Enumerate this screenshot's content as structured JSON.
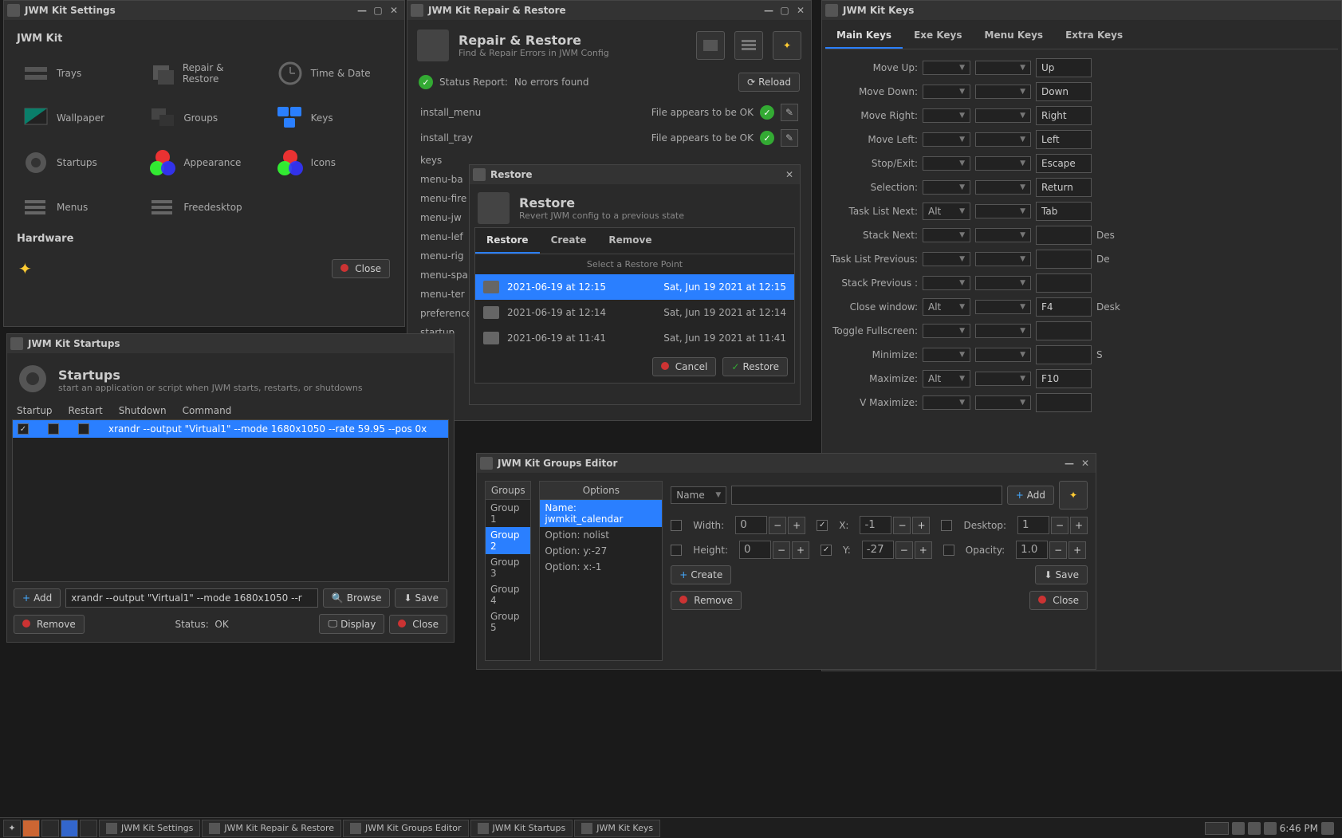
{
  "settings": {
    "title": "JWM Kit Settings",
    "jwm_section": "JWM Kit",
    "hardware_section": "Hardware",
    "close": "Close",
    "tiles": {
      "trays": "Trays",
      "repair": "Repair & Restore",
      "time": "Time & Date",
      "wallpaper": "Wallpaper",
      "groups": "Groups",
      "keys": "Keys",
      "startups": "Startups",
      "appearance": "Appearance",
      "icons": "Icons",
      "menus": "Menus",
      "freedesktop": "Freedesktop"
    }
  },
  "repair": {
    "title": "JWM Kit Repair & Restore",
    "header": "Repair & Restore",
    "sub": "Find & Repair Errors in JWM Config",
    "status_label": "Status Report:",
    "status_val": "No errors found",
    "reload": "Reload",
    "ok_text": "File appears to be OK",
    "files": [
      "install_menu",
      "install_tray",
      "keys",
      "menu-ba",
      "menu-fire",
      "menu-jw",
      "menu-lef",
      "menu-rig",
      "menu-spa",
      "menu-ter",
      "preference",
      "startup"
    ]
  },
  "restore": {
    "title": "Restore",
    "header": "Restore",
    "sub": "Revert JWM config to a previous state",
    "tabs": {
      "restore": "Restore",
      "create": "Create",
      "remove": "Remove"
    },
    "help": "Select a Restore Point",
    "cancel": "Cancel",
    "restore_btn": "Restore",
    "points": [
      {
        "short": "2021-06-19 at 12:15",
        "long": "Sat, Jun 19 2021 at 12:15"
      },
      {
        "short": "2021-06-19 at 12:14",
        "long": "Sat, Jun 19 2021 at 12:14"
      },
      {
        "short": "2021-06-19 at 11:41",
        "long": "Sat, Jun 19 2021 at 11:41"
      }
    ]
  },
  "startups": {
    "title": "JWM Kit Startups",
    "header": "Startups",
    "sub": "start an application or script when JWM starts, restarts, or shutdowns",
    "cols": {
      "startup": "Startup",
      "restart": "Restart",
      "shutdown": "Shutdown",
      "command": "Command"
    },
    "row_cmd": "xrandr --output \"Virtual1\" --mode 1680x1050 --rate 59.95 --pos 0x",
    "input_cmd": "xrandr --output \"Virtual1\" --mode 1680x1050 --r",
    "add": "Add",
    "browse": "Browse",
    "save": "Save",
    "remove": "Remove",
    "display": "Display",
    "close": "Close",
    "status_label": "Status:",
    "status_val": "OK"
  },
  "keys": {
    "title": "JWM Kit Keys",
    "tabs": {
      "main": "Main Keys",
      "exe": "Exe Keys",
      "menu": "Menu Keys",
      "extra": "Extra Keys"
    },
    "rows": [
      {
        "label": "Move Up:",
        "m1": "",
        "m2": "",
        "key": "Up",
        "ex": ""
      },
      {
        "label": "Move Down:",
        "m1": "",
        "m2": "",
        "key": "Down",
        "ex": ""
      },
      {
        "label": "Move Right:",
        "m1": "",
        "m2": "",
        "key": "Right",
        "ex": ""
      },
      {
        "label": "Move Left:",
        "m1": "",
        "m2": "",
        "key": "Left",
        "ex": ""
      },
      {
        "label": "Stop/Exit:",
        "m1": "",
        "m2": "",
        "key": "Escape",
        "ex": ""
      },
      {
        "label": "Selection:",
        "m1": "",
        "m2": "",
        "key": "Return",
        "ex": ""
      },
      {
        "label": "Task List Next:",
        "m1": "Alt",
        "m2": "",
        "key": "Tab",
        "ex": ""
      },
      {
        "label": "Stack Next:",
        "m1": "",
        "m2": "",
        "key": "",
        "ex": "Des"
      },
      {
        "label": "Task List Previous:",
        "m1": "",
        "m2": "",
        "key": "",
        "ex": "De"
      },
      {
        "label": "Stack Previous :",
        "m1": "",
        "m2": "",
        "key": "",
        "ex": ""
      },
      {
        "label": "Close window:",
        "m1": "Alt",
        "m2": "",
        "key": "F4",
        "ex": "Desk"
      },
      {
        "label": "Toggle Fullscreen:",
        "m1": "",
        "m2": "",
        "key": "",
        "ex": ""
      },
      {
        "label": "Minimize:",
        "m1": "",
        "m2": "",
        "key": "",
        "ex": "S"
      },
      {
        "label": "Maximize:",
        "m1": "Alt",
        "m2": "",
        "key": "F10",
        "ex": ""
      },
      {
        "label": "V Maximize:",
        "m1": "",
        "m2": "",
        "key": "",
        "ex": ""
      }
    ]
  },
  "groups": {
    "title": "JWM Kit Groups Editor",
    "groups_h": "Groups",
    "options_h": "Options",
    "groups": [
      "Group 1",
      "Group 2",
      "Group 3",
      "Group 4",
      "Group 5"
    ],
    "options": [
      "Name: jwmkit_calendar",
      "Option: nolist",
      "Option: y:-27",
      "Option: x:-1"
    ],
    "name_dd": "Name",
    "add": "Add",
    "width_l": "Width:",
    "width_v": "0",
    "height_l": "Height:",
    "height_v": "0",
    "x_l": "X:",
    "x_v": "-1",
    "y_l": "Y:",
    "y_v": "-27",
    "desktop_l": "Desktop:",
    "desktop_v": "1",
    "opacity_l": "Opacity:",
    "opacity_v": "1.0",
    "create": "Create",
    "save": "Save",
    "remove": "Remove",
    "close": "Close"
  },
  "taskbar": {
    "tasks": [
      "JWM Kit Settings",
      "JWM Kit Repair & Restore",
      "JWM Kit Groups Editor",
      "JWM Kit Startups",
      "JWM Kit Keys"
    ],
    "time": "6:46 PM"
  }
}
